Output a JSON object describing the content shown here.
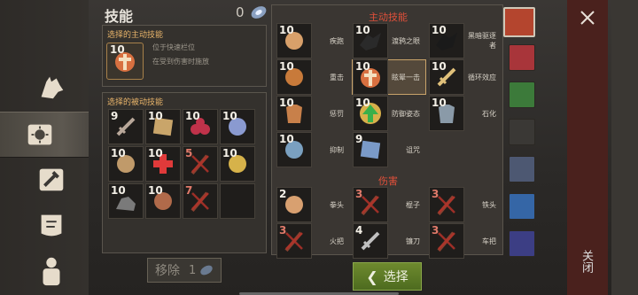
{
  "header": {
    "title": "技能",
    "count": "0"
  },
  "selected_active": {
    "heading": "选择的主动技能",
    "level": "10",
    "hint1": "位于快速栏位",
    "hint2": "在受到伤害时施放"
  },
  "passive": {
    "heading": "选择的被动技能",
    "slots": [
      {
        "level": "9",
        "icon": "claw-icon",
        "color": "#b9a89a",
        "red": false
      },
      {
        "level": "10",
        "icon": "map-icon",
        "color": "#c9a56a",
        "red": false
      },
      {
        "level": "10",
        "icon": "berries-icon",
        "color": "#c0324a",
        "red": false
      },
      {
        "level": "10",
        "icon": "wave-icon",
        "color": "#8a9ad0",
        "red": false
      },
      {
        "level": "10",
        "icon": "boots-icon",
        "color": "#c09a6a",
        "red": false
      },
      {
        "level": "10",
        "icon": "red-cross-icon",
        "color": "#e03a3a",
        "red": false
      },
      {
        "level": "5",
        "icon": "locked-stick-icon",
        "color": "#8a4030",
        "red": true
      },
      {
        "level": "10",
        "icon": "heal-hand-icon",
        "color": "#d6b24a",
        "red": false
      },
      {
        "level": "10",
        "icon": "ore-icon",
        "color": "#7a7a7a",
        "red": false
      },
      {
        "level": "10",
        "icon": "meat-icon",
        "color": "#b06a4a",
        "red": false
      },
      {
        "level": "7",
        "icon": "locked-stick-icon",
        "color": "#8a4030",
        "red": true
      },
      {
        "level": "",
        "icon": "",
        "color": "",
        "red": false
      }
    ]
  },
  "remove": {
    "label": "移除",
    "count": "1"
  },
  "active_section": "主动技能",
  "active_skills": [
    {
      "level": "10",
      "name": "疾跑",
      "icon": "leg-icon",
      "color": "#d8a06a"
    },
    {
      "level": "10",
      "name": "渡鸦之眼",
      "icon": "raven-icon",
      "color": "#2a2a2a"
    },
    {
      "level": "10",
      "name": "黑暗驱逐者",
      "icon": "shadow-icon",
      "color": "#1a1a1a"
    },
    {
      "level": "10",
      "name": "重击",
      "icon": "hammer-icon",
      "color": "#c87a3a"
    },
    {
      "level": "10",
      "name": "眩晕一击",
      "icon": "shield-strike-icon",
      "color": "#d87040"
    },
    {
      "level": "10",
      "name": "循环效应",
      "icon": "sword-icon",
      "color": "#e0c07a"
    },
    {
      "level": "10",
      "name": "惩罚",
      "icon": "chest-icon",
      "color": "#c8804a"
    },
    {
      "level": "10",
      "name": "防御姿态",
      "icon": "up-arrow-icon",
      "color": "#3ab04a"
    },
    {
      "level": "10",
      "name": "石化",
      "icon": "armor-icon",
      "color": "#8a9aa8"
    },
    {
      "level": "10",
      "name": "抑制",
      "icon": "gauntlet-icon",
      "color": "#7aa0c0"
    },
    {
      "level": "9",
      "name": "诅咒",
      "icon": "sigil-icon",
      "color": "#7a9ac8"
    }
  ],
  "damage_section": "伤害",
  "damage_skills": [
    {
      "level": "2",
      "name": "拳头",
      "icon": "fist-icon",
      "color": "#d8a070",
      "locked": false
    },
    {
      "level": "3",
      "name": "棍子",
      "icon": "stick-icon",
      "color": "#8a4030",
      "locked": true
    },
    {
      "level": "3",
      "name": "铁头",
      "icon": "stick-icon",
      "color": "#8a4030",
      "locked": true
    },
    {
      "level": "3",
      "name": "火把",
      "icon": "torch-icon",
      "color": "#8a4030",
      "locked": true
    },
    {
      "level": "4",
      "name": "镰刀",
      "icon": "sickle-icon",
      "color": "#c0c0c0",
      "locked": false
    },
    {
      "level": "3",
      "name": "车把",
      "icon": "stick-icon",
      "color": "#8a4030",
      "locked": true
    }
  ],
  "tabs": [
    "#b4452e",
    "#a8353a",
    "#3c7a3a",
    "#3a3835",
    "#4d5872",
    "#3566a6",
    "#3c3e84"
  ],
  "select_label": "选择",
  "close_label": "关闭"
}
